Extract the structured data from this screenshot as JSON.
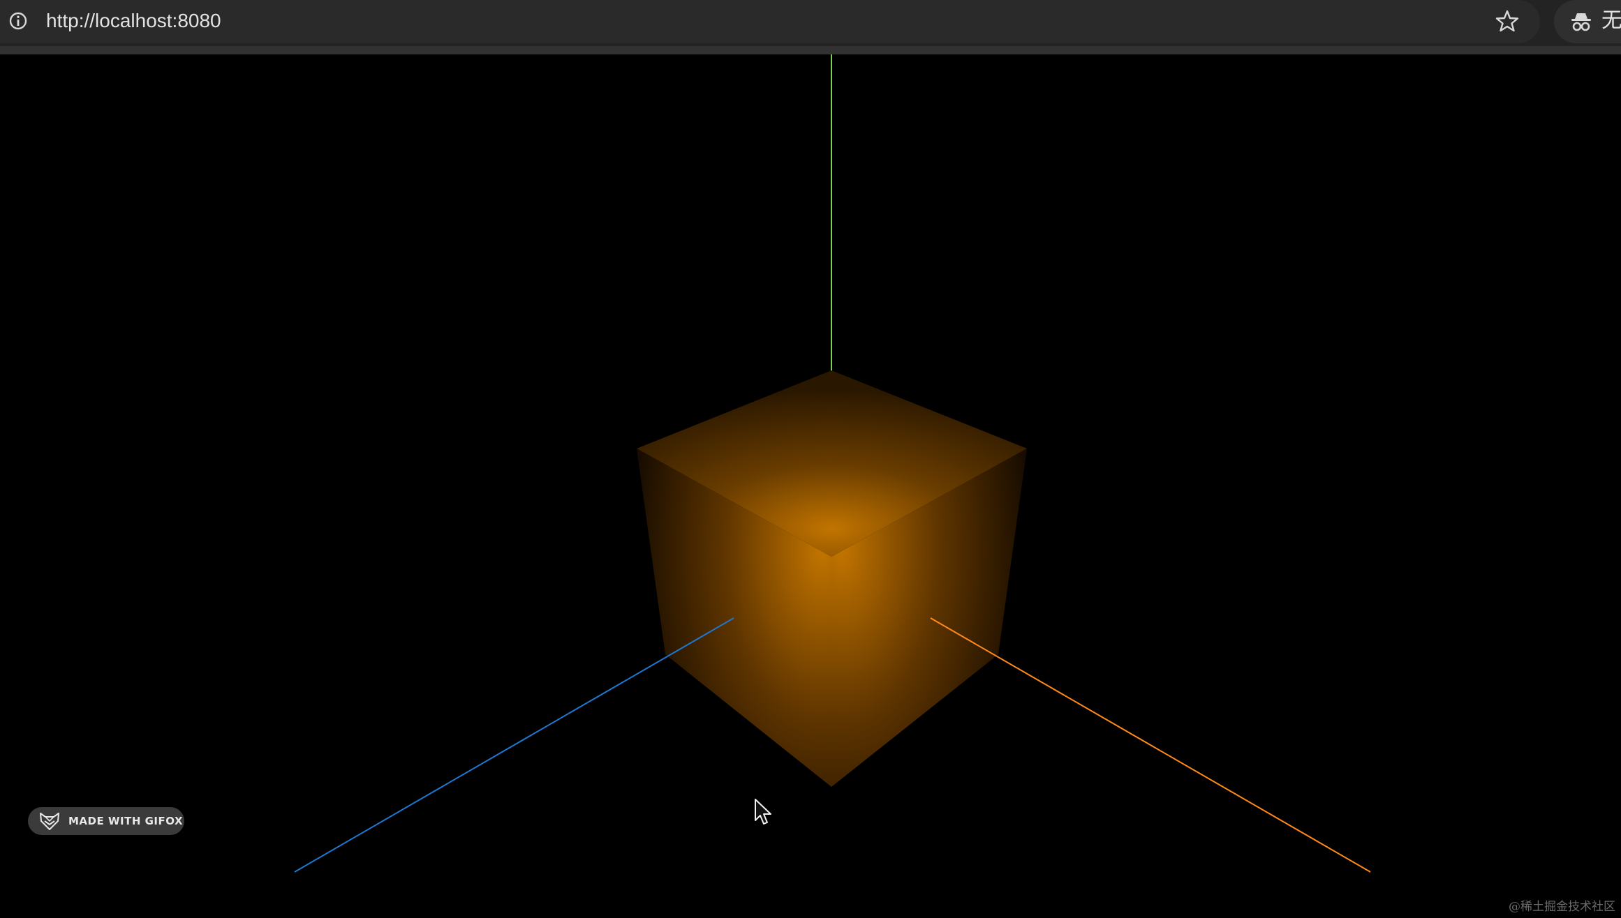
{
  "browser": {
    "url": "http://localhost:8080",
    "profile_label": "无",
    "icons": {
      "info": "info-icon",
      "bookmark": "star-icon",
      "profile": "incognito-icon"
    }
  },
  "scene": {
    "object": "cube",
    "colors": {
      "cube": "#d08000",
      "axis_y": "#7fd14f",
      "axis_x": "#ff8a1a",
      "axis_z": "#1f78d1"
    }
  },
  "overlay": {
    "badge_label": "MADE WITH GIFOX",
    "badge_icon": "fox-icon",
    "watermark": "@稀土掘金技术社区"
  }
}
